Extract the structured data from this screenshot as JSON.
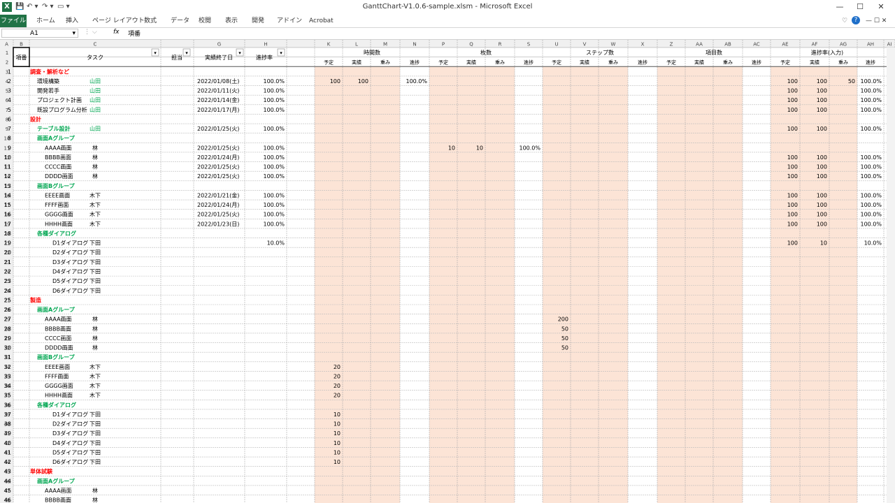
{
  "window": {
    "title": "GanttChart-V1.0.6-sample.xlsm  -  Microsoft Excel",
    "app_icon": "excel-icon",
    "help": "?",
    "controls": {
      "min": "—",
      "max": "☐",
      "close": "✕"
    }
  },
  "ribbon": {
    "file_tab": "ファイル",
    "tabs": [
      "ホーム",
      "挿入",
      "ページ レイアウト",
      "数式",
      "データ",
      "校閲",
      "表示",
      "開発",
      "アドイン",
      "Acrobat"
    ]
  },
  "formula_bar": {
    "name_box": "A1",
    "fx": "fx",
    "content": "項番"
  },
  "colors": {
    "excel_green": "#217346",
    "phase_red": "#ff0000",
    "group_green": "#00a651",
    "assignee_green": "#00a651",
    "shade": "#fce4d6",
    "header_bg": "#f0f0f0"
  },
  "sheet": {
    "column_letters": [
      "A",
      "B",
      "C",
      "",
      "G",
      "H",
      "",
      "K",
      "L",
      "M",
      "N",
      "P",
      "Q",
      "R",
      "S",
      "U",
      "V",
      "W",
      "X",
      "Z",
      "AA",
      "AB",
      "AC",
      "AE",
      "AF",
      "AG",
      "AH",
      "AI"
    ],
    "headers": {
      "koban": "項番",
      "task": "タスク",
      "tanto": "担当",
      "end_date": "実績終了日",
      "progress": "進捗率",
      "groups": [
        "時間数",
        "枚数",
        "ステップ数",
        "項目数",
        "進捗率(入力)"
      ],
      "sub": [
        "予定",
        "実績",
        "重み",
        "進捗"
      ]
    },
    "rows": [
      {
        "r": 3,
        "no": "1",
        "task": "調査・解析など",
        "type": "phase"
      },
      {
        "r": 4,
        "no": "2",
        "task": "環境構築",
        "type": "task",
        "indent": 1,
        "tanto": "山田",
        "date": "2022/01/08(土)",
        "prog": "100.0%",
        "v": {
          "K": "100",
          "L": "100",
          "N": "100.0%",
          "AE": "100",
          "AF": "100",
          "AG": "50",
          "AH": "100.0%"
        }
      },
      {
        "r": 5,
        "no": "3",
        "task": "開発若手",
        "type": "task",
        "indent": 1,
        "tanto": "山田",
        "date": "2022/01/11(火)",
        "prog": "100.0%",
        "v": {
          "AE": "100",
          "AF": "100",
          "AH": "100.0%"
        }
      },
      {
        "r": 6,
        "no": "4",
        "task": "プロジェクト計画",
        "type": "task",
        "indent": 1,
        "tanto": "山田",
        "date": "2022/01/14(金)",
        "prog": "100.0%",
        "v": {
          "AE": "100",
          "AF": "100",
          "AH": "100.0%"
        }
      },
      {
        "r": 7,
        "no": "5",
        "task": "既設プログラム分析",
        "type": "task",
        "indent": 1,
        "tanto": "山田",
        "date": "2022/01/17(月)",
        "prog": "100.0%",
        "v": {
          "AE": "100",
          "AF": "100",
          "AH": "100.0%"
        }
      },
      {
        "r": 8,
        "no": "6",
        "task": "設計",
        "type": "phase"
      },
      {
        "r": 9,
        "no": "7",
        "task": "テーブル設計",
        "type": "group",
        "tanto": "山田",
        "date": "2022/01/25(火)",
        "prog": "100.0%",
        "v": {
          "AE": "100",
          "AF": "100",
          "AH": "100.0%"
        }
      },
      {
        "r": 10,
        "no": "8",
        "task": "画面Aグループ",
        "type": "group"
      },
      {
        "r": 11,
        "no": "9",
        "task": "AAAA画面",
        "type": "task",
        "indent": 2,
        "tanto": "林",
        "date": "2022/01/25(火)",
        "prog": "100.0%",
        "v": {
          "P": "10",
          "Q": "10",
          "S": "100.0%"
        }
      },
      {
        "r": 12,
        "no": "10",
        "task": "BBBB画面",
        "type": "task",
        "indent": 2,
        "tanto": "林",
        "date": "2022/01/24(月)",
        "prog": "100.0%",
        "v": {
          "AE": "100",
          "AF": "100",
          "AH": "100.0%"
        }
      },
      {
        "r": 13,
        "no": "11",
        "task": "CCCC画面",
        "type": "task",
        "indent": 2,
        "tanto": "林",
        "date": "2022/01/25(火)",
        "prog": "100.0%",
        "v": {
          "AE": "100",
          "AF": "100",
          "AH": "100.0%"
        }
      },
      {
        "r": 14,
        "no": "12",
        "task": "DDDD画面",
        "type": "task",
        "indent": 2,
        "tanto": "林",
        "date": "2022/01/25(火)",
        "prog": "100.0%",
        "v": {
          "AE": "100",
          "AF": "100",
          "AH": "100.0%"
        }
      },
      {
        "r": 15,
        "no": "13",
        "task": "画面Bグループ",
        "type": "group"
      },
      {
        "r": 16,
        "no": "14",
        "task": "EEEE画面",
        "type": "task",
        "indent": 2,
        "tanto": "木下",
        "date": "2022/01/21(金)",
        "prog": "100.0%",
        "v": {
          "AE": "100",
          "AF": "100",
          "AH": "100.0%"
        }
      },
      {
        "r": 17,
        "no": "15",
        "task": "FFFF画面",
        "type": "task",
        "indent": 2,
        "tanto": "木下",
        "date": "2022/01/24(月)",
        "prog": "100.0%",
        "v": {
          "AE": "100",
          "AF": "100",
          "AH": "100.0%"
        }
      },
      {
        "r": 18,
        "no": "16",
        "task": "GGGG画面",
        "type": "task",
        "indent": 2,
        "tanto": "木下",
        "date": "2022/01/25(火)",
        "prog": "100.0%",
        "v": {
          "AE": "100",
          "AF": "100",
          "AH": "100.0%"
        }
      },
      {
        "r": 19,
        "no": "17",
        "task": "HHHH画面",
        "type": "task",
        "indent": 2,
        "tanto": "木下",
        "date": "2022/01/23(日)",
        "prog": "100.0%",
        "v": {
          "AE": "100",
          "AF": "100",
          "AH": "100.0%"
        }
      },
      {
        "r": 20,
        "no": "18",
        "task": "各種ダイアログ",
        "type": "group"
      },
      {
        "r": 21,
        "no": "19",
        "task": "D1ダイアログ",
        "type": "task",
        "indent": 3,
        "tanto": "下田",
        "prog": "10.0%",
        "v": {
          "AE": "100",
          "AF": "10",
          "AH": "10.0%"
        }
      },
      {
        "r": 22,
        "no": "20",
        "task": "D2ダイアログ",
        "type": "task",
        "indent": 3,
        "tanto": "下田"
      },
      {
        "r": 23,
        "no": "21",
        "task": "D3ダイアログ",
        "type": "task",
        "indent": 3,
        "tanto": "下田"
      },
      {
        "r": 24,
        "no": "22",
        "task": "D4ダイアログ",
        "type": "task",
        "indent": 3,
        "tanto": "下田"
      },
      {
        "r": 25,
        "no": "23",
        "task": "D5ダイアログ",
        "type": "task",
        "indent": 3,
        "tanto": "下田"
      },
      {
        "r": 26,
        "no": "24",
        "task": "D6ダイアログ",
        "type": "task",
        "indent": 3,
        "tanto": "下田"
      },
      {
        "r": 27,
        "no": "25",
        "task": "製造",
        "type": "phase"
      },
      {
        "r": 28,
        "no": "26",
        "task": "画面Aグループ",
        "type": "group"
      },
      {
        "r": 29,
        "no": "27",
        "task": "AAAA画面",
        "type": "task",
        "indent": 2,
        "tanto": "林",
        "v": {
          "U": "200"
        }
      },
      {
        "r": 30,
        "no": "28",
        "task": "BBBB画面",
        "type": "task",
        "indent": 2,
        "tanto": "林",
        "v": {
          "U": "50"
        }
      },
      {
        "r": 31,
        "no": "29",
        "task": "CCCC画面",
        "type": "task",
        "indent": 2,
        "tanto": "林",
        "v": {
          "U": "50"
        }
      },
      {
        "r": 32,
        "no": "30",
        "task": "DDDD画面",
        "type": "task",
        "indent": 2,
        "tanto": "林",
        "v": {
          "U": "50"
        }
      },
      {
        "r": 33,
        "no": "31",
        "task": "画面Bグループ",
        "type": "group"
      },
      {
        "r": 34,
        "no": "32",
        "task": "EEEE画面",
        "type": "task",
        "indent": 2,
        "tanto": "木下",
        "v": {
          "K": "20"
        }
      },
      {
        "r": 35,
        "no": "33",
        "task": "FFFF画面",
        "type": "task",
        "indent": 2,
        "tanto": "木下",
        "v": {
          "K": "20"
        }
      },
      {
        "r": 36,
        "no": "34",
        "task": "GGGG画面",
        "type": "task",
        "indent": 2,
        "tanto": "木下",
        "v": {
          "K": "20"
        }
      },
      {
        "r": 37,
        "no": "35",
        "task": "HHHH画面",
        "type": "task",
        "indent": 2,
        "tanto": "木下",
        "v": {
          "K": "20"
        }
      },
      {
        "r": 38,
        "no": "36",
        "task": "各種ダイアログ",
        "type": "group"
      },
      {
        "r": 39,
        "no": "37",
        "task": "D1ダイアログ",
        "type": "task",
        "indent": 3,
        "tanto": "下田",
        "v": {
          "K": "10"
        }
      },
      {
        "r": 40,
        "no": "38",
        "task": "D2ダイアログ",
        "type": "task",
        "indent": 3,
        "tanto": "下田",
        "v": {
          "K": "10"
        }
      },
      {
        "r": 41,
        "no": "39",
        "task": "D3ダイアログ",
        "type": "task",
        "indent": 3,
        "tanto": "下田",
        "v": {
          "K": "10"
        }
      },
      {
        "r": 42,
        "no": "40",
        "task": "D4ダイアログ",
        "type": "task",
        "indent": 3,
        "tanto": "下田",
        "v": {
          "K": "10"
        }
      },
      {
        "r": 43,
        "no": "41",
        "task": "D5ダイアログ",
        "type": "task",
        "indent": 3,
        "tanto": "下田",
        "v": {
          "K": "10"
        }
      },
      {
        "r": 44,
        "no": "42",
        "task": "D6ダイアログ",
        "type": "task",
        "indent": 3,
        "tanto": "下田",
        "v": {
          "K": "10"
        }
      },
      {
        "r": 45,
        "no": "43",
        "task": "単体試験",
        "type": "phase"
      },
      {
        "r": 46,
        "no": "44",
        "task": "画面Aグループ",
        "type": "group"
      },
      {
        "r": 47,
        "no": "45",
        "task": "AAAA画面",
        "type": "task",
        "indent": 2,
        "tanto": "林"
      },
      {
        "r": 48,
        "no": "46",
        "task": "BBBB画面",
        "type": "task",
        "indent": 2,
        "tanto": "林"
      }
    ]
  }
}
